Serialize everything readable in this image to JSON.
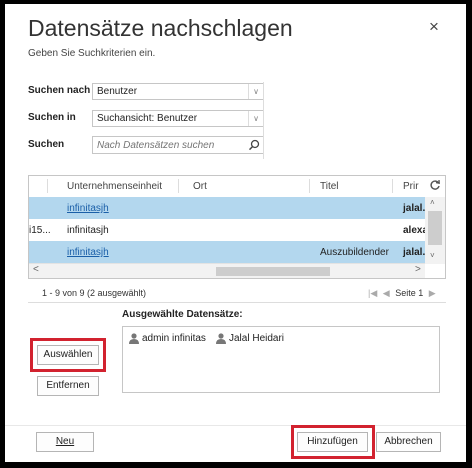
{
  "dialog": {
    "title": "Datensätze nachschlagen",
    "subtitle": "Geben Sie Suchkriterien ein.",
    "close_icon": "×"
  },
  "criteria": {
    "search_by_label": "Suchen nach",
    "search_by_value": "Benutzer",
    "search_in_label": "Suchen in",
    "search_in_value": "Suchansicht: Benutzer",
    "search_label": "Suchen",
    "search_placeholder": "Nach Datensätzen suchen"
  },
  "grid": {
    "columns": [
      "Unternehmenseinheit",
      "Ort",
      "Titel",
      "Prir"
    ],
    "refresh_icon": "refresh-icon",
    "rows": [
      {
        "prefix": "",
        "unit": "infinitasjh",
        "ort": "",
        "titel": "",
        "prim": "jalal.h",
        "selected": true,
        "link": true
      },
      {
        "prefix": "i15...",
        "unit": "infinitasjh",
        "ort": "",
        "titel": "",
        "prim": "alexar",
        "selected": false,
        "link": false
      },
      {
        "prefix": "",
        "unit": "infinitasjh",
        "ort": "",
        "titel": "Auszubildender",
        "prim": "jalal.h",
        "selected": true,
        "link": true
      }
    ]
  },
  "pager": {
    "info": "1 - 9  von 9 (2 ausgewählt)",
    "page_label": "Seite 1"
  },
  "selected": {
    "label": "Ausgewählte Datensätze:",
    "items": [
      "admin infinitas",
      "Jalal Heidari"
    ]
  },
  "buttons": {
    "select": "Auswählen",
    "remove": "Entfernen",
    "new": "Neu",
    "add": "Hinzufügen",
    "cancel": "Abbrechen"
  },
  "colors": {
    "highlight": "#d2222f",
    "selected_row": "#b3d7ee",
    "link": "#1a5fa8"
  }
}
